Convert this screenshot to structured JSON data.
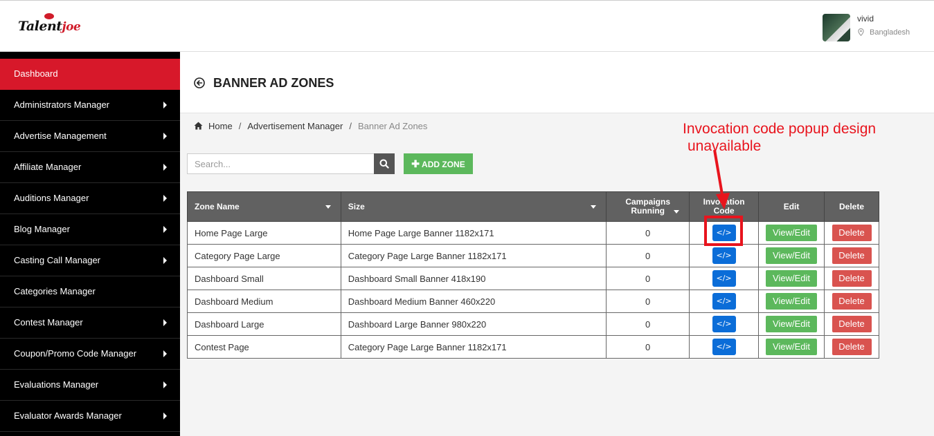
{
  "header": {
    "logo_text": "Talent",
    "logo_accent": "joe",
    "user": {
      "name": "vivid",
      "location": "Bangladesh"
    }
  },
  "sidebar": {
    "items": [
      {
        "label": "Dashboard",
        "active": true,
        "has_submenu": false
      },
      {
        "label": "Administrators Manager",
        "has_submenu": true
      },
      {
        "label": "Advertise Management",
        "has_submenu": true
      },
      {
        "label": "Affiliate Manager",
        "has_submenu": true
      },
      {
        "label": "Auditions Manager",
        "has_submenu": true
      },
      {
        "label": "Blog Manager",
        "has_submenu": true
      },
      {
        "label": "Casting Call Manager",
        "has_submenu": true
      },
      {
        "label": "Categories Manager",
        "has_submenu": false
      },
      {
        "label": "Contest Manager",
        "has_submenu": true
      },
      {
        "label": "Coupon/Promo Code Manager",
        "has_submenu": true
      },
      {
        "label": "Evaluations Manager",
        "has_submenu": true
      },
      {
        "label": "Evaluator Awards Manager",
        "has_submenu": true
      }
    ]
  },
  "page": {
    "title": "BANNER AD ZONES",
    "breadcrumb": [
      "Home",
      "Advertisement Manager",
      "Banner Ad Zones"
    ]
  },
  "toolbar": {
    "search_placeholder": "Search...",
    "add_label": "ADD ZONE"
  },
  "table": {
    "headers": {
      "zone_name": "Zone Name",
      "size": "Size",
      "campaigns_l1": "Campaigns",
      "campaigns_l2": "Running",
      "invocation_l1": "Invocation",
      "invocation_l2": "Code",
      "edit": "Edit",
      "delete": "Delete"
    },
    "code_glyph": "</>",
    "edit_label": "View/Edit",
    "delete_label": "Delete",
    "rows": [
      {
        "zone": "Home Page Large",
        "size": "Home Page Large Banner 1182x171",
        "campaigns": "0"
      },
      {
        "zone": "Category Page Large",
        "size": "Category Page Large Banner 1182x171",
        "campaigns": "0"
      },
      {
        "zone": "Dashboard Small",
        "size": "Dashboard Small Banner 418x190",
        "campaigns": "0"
      },
      {
        "zone": "Dashboard Medium",
        "size": "Dashboard Medium Banner 460x220",
        "campaigns": "0"
      },
      {
        "zone": "Dashboard Large",
        "size": "Dashboard Large Banner 980x220",
        "campaigns": "0"
      },
      {
        "zone": "Contest Page",
        "size": "Category Page Large Banner 1182x171",
        "campaigns": "0"
      }
    ]
  },
  "annotation": {
    "line1": "Invocation code popup design",
    "line2": "unavailable",
    "color": "#e8141d"
  },
  "colors": {
    "sidebar_bg": "#000000",
    "sidebar_active": "#d7182a",
    "success": "#5cb85c",
    "danger": "#d9534f",
    "primary": "#0b6dd8",
    "table_header": "#616161"
  }
}
